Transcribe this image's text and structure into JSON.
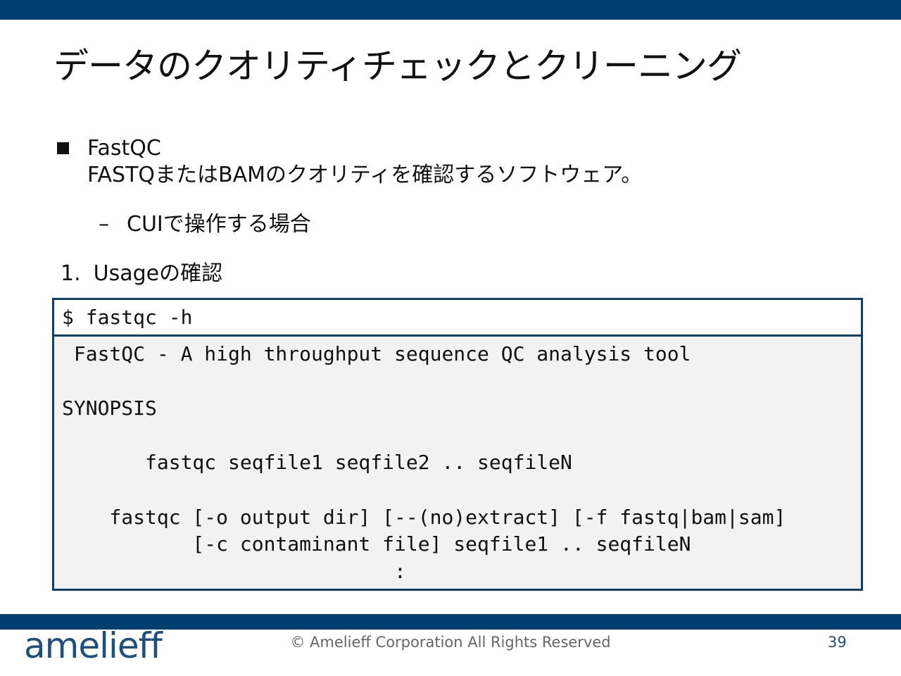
{
  "colors": {
    "brand_navy": "#003f70",
    "logo_blue": "#1d4f7f",
    "page_number": "#1d4f7f"
  },
  "slide": {
    "title": "データのクオリティチェックとクリーニング",
    "bullet": {
      "name": "FastQC",
      "description": "FASTQまたはBAMのクオリティを確認するソフトウェア。"
    },
    "sub_bullet": {
      "dash": "–",
      "text": "CUIで操作する場合"
    },
    "step": {
      "number": "1.",
      "text": "Usageの確認"
    },
    "terminal": {
      "command": "$ fastqc -h",
      "output_lines": [
        " FastQC - A high throughput sequence QC analysis tool",
        "",
        "SYNOPSIS",
        "",
        "       fastqc seqfile1 seqfile2 .. seqfileN",
        "",
        "    fastqc [-o output dir] [--(no)extract] [-f fastq|bam|sam]",
        "           [-c contaminant file] seqfile1 .. seqfileN",
        "                            :"
      ]
    }
  },
  "footer": {
    "logo": "amelieff",
    "copyright": "© Amelieff Corporation All Rights Reserved",
    "page_number": "39"
  }
}
